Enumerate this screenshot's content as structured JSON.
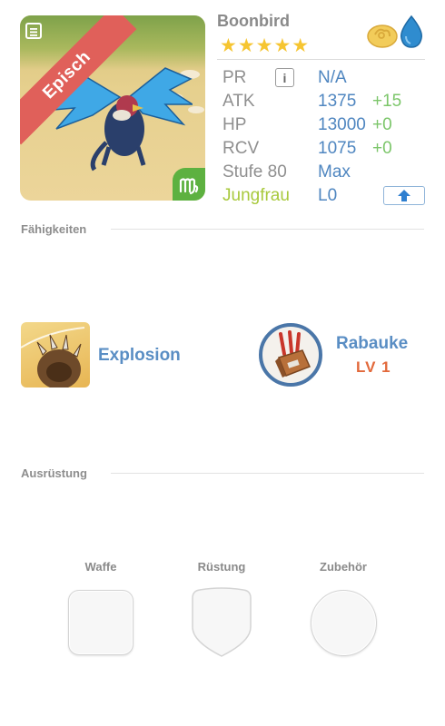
{
  "monster": {
    "name": "Boonbird",
    "rarity": "Episch",
    "stars": "★★★★★",
    "element_icons": [
      "cloud-icon",
      "water-drop-icon"
    ],
    "zodiac_icon": "virgo-icon"
  },
  "stats": [
    {
      "label": "PR",
      "value": "N/A",
      "bonus": ""
    },
    {
      "label": "ATK",
      "value": "1375",
      "bonus": "+15"
    },
    {
      "label": "HP",
      "value": "13000",
      "bonus": "+0"
    },
    {
      "label": "RCV",
      "value": "1075",
      "bonus": "+0"
    },
    {
      "label": "Stufe 80",
      "value": "Max",
      "bonus": ""
    }
  ],
  "zodiac": {
    "label": "Jungfrau",
    "value": "L0"
  },
  "sections": {
    "skills": "Fähigkeiten",
    "equipment": "Ausrüstung"
  },
  "skill": {
    "name": "Explosion"
  },
  "ability": {
    "name": "Rabauke",
    "level": "LV 1"
  },
  "equipment_slots": [
    {
      "label": "Waffe"
    },
    {
      "label": "Rüstung"
    },
    {
      "label": "Zubehör"
    }
  ],
  "colors": {
    "accent_blue": "#4f86c0",
    "bonus_green": "#7cc66a",
    "zodiac_green": "#a8c93c",
    "rarity_red": "#e0605a",
    "star_gold": "#f6c531",
    "level_orange": "#e2693b"
  }
}
